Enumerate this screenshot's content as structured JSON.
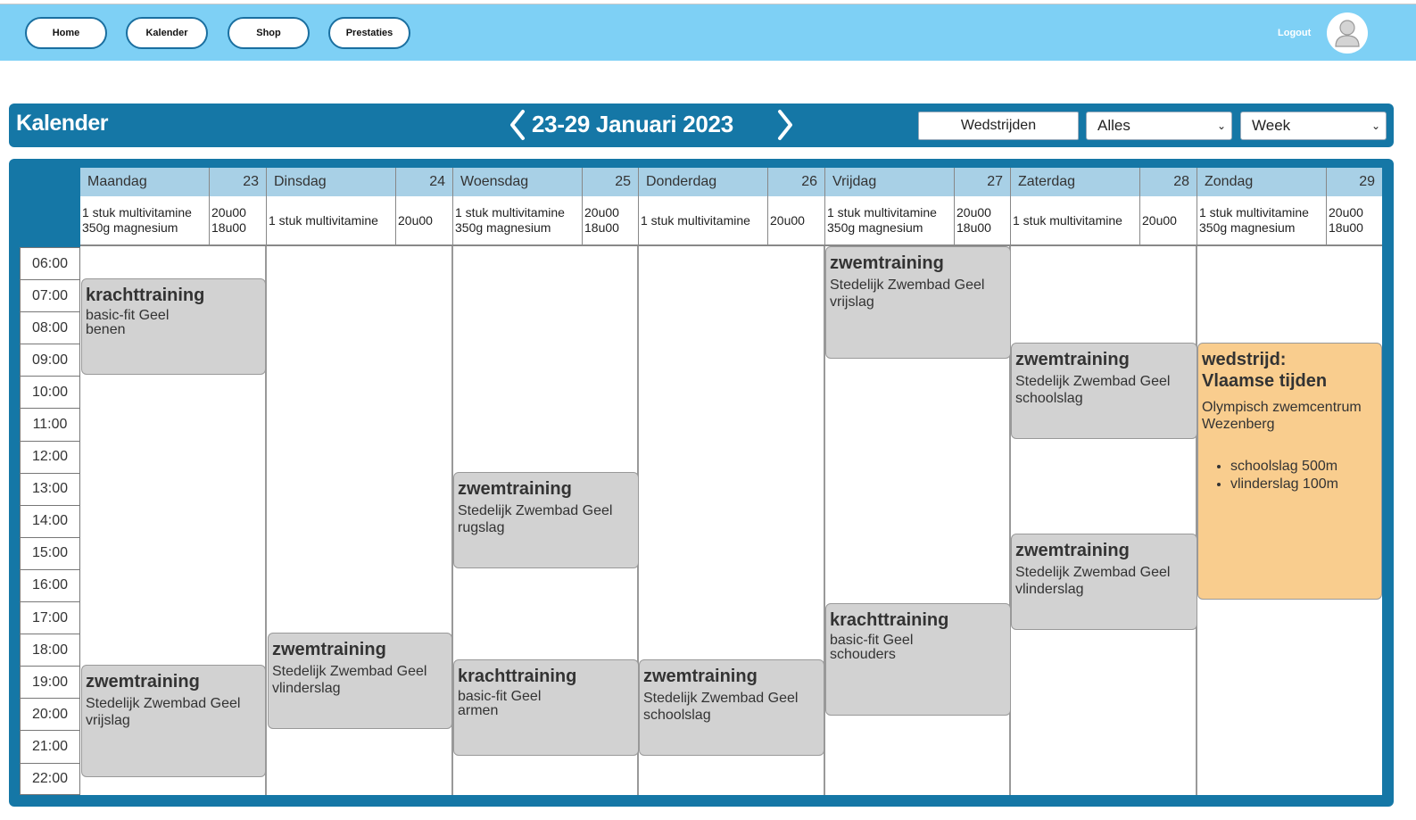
{
  "nav": {
    "home": "Home",
    "kalender": "Kalender",
    "shop": "Shop",
    "prestaties": "Prestaties",
    "logout": "Logout"
  },
  "header": {
    "title": "Kalender",
    "range": "23-29 Januari 2023",
    "wedstrijden_btn": "Wedstrijden",
    "filter_select": "Alles",
    "view_select": "Week"
  },
  "days": [
    {
      "name": "Maandag",
      "num": "23",
      "supp1": "1 stuk multivitamine",
      "supp2": "350g magnesium",
      "t1": "20u00",
      "t2": "18u00"
    },
    {
      "name": "Dinsdag",
      "num": "24",
      "supp1": "1 stuk multivitamine",
      "supp2": "",
      "t1": "20u00",
      "t2": ""
    },
    {
      "name": "Woensdag",
      "num": "25",
      "supp1": "1 stuk multivitamine",
      "supp2": "350g magnesium",
      "t1": "20u00",
      "t2": "18u00"
    },
    {
      "name": "Donderdag",
      "num": "26",
      "supp1": "1 stuk multivitamine",
      "supp2": "",
      "t1": "20u00",
      "t2": ""
    },
    {
      "name": "Vrijdag",
      "num": "27",
      "supp1": "1 stuk multivitamine",
      "supp2": "350g magnesium",
      "t1": "20u00",
      "t2": "18u00"
    },
    {
      "name": "Zaterdag",
      "num": "28",
      "supp1": "1 stuk multivitamine",
      "supp2": "",
      "t1": "20u00",
      "t2": ""
    },
    {
      "name": "Zondag",
      "num": "29",
      "supp1": "1 stuk multivitamine",
      "supp2": "350g magnesium",
      "t1": "20u00",
      "t2": "18u00"
    }
  ],
  "times": [
    "06:00",
    "07:00",
    "08:00",
    "09:00",
    "10:00",
    "11:00",
    "12:00",
    "13:00",
    "14:00",
    "15:00",
    "16:00",
    "17:00",
    "18:00",
    "19:00",
    "20:00",
    "21:00",
    "22:00"
  ],
  "events": {
    "mon_kracht": {
      "title": "krachttraining",
      "loc": "basic-fit Geel",
      "detail": "benen"
    },
    "mon_zwem": {
      "title": "zwemtraining",
      "loc": "Stedelijk Zwembad Geel",
      "detail": "vrijslag"
    },
    "tue_zwem": {
      "title": "zwemtraining",
      "loc": "Stedelijk Zwembad Geel",
      "detail": "vlinderslag"
    },
    "wed_zwem": {
      "title": "zwemtraining",
      "loc": "Stedelijk Zwembad Geel",
      "detail": "rugslag"
    },
    "wed_kracht": {
      "title": "krachttraining",
      "loc": "basic-fit Geel",
      "detail": "armen"
    },
    "thu_zwem": {
      "title": "zwemtraining",
      "loc": "Stedelijk Zwembad Geel",
      "detail": "schoolslag"
    },
    "fri_zwem": {
      "title": "zwemtraining",
      "loc": "Stedelijk Zwembad Geel",
      "detail": "vrijslag"
    },
    "fri_kracht": {
      "title": "krachttraining",
      "loc": "basic-fit Geel",
      "detail": "schouders"
    },
    "sat_zwem1": {
      "title": "zwemtraining",
      "loc": "Stedelijk Zwembad Geel",
      "detail": "schoolslag"
    },
    "sat_zwem2": {
      "title": "zwemtraining",
      "loc": "Stedelijk Zwembad Geel",
      "detail": "vlinderslag"
    },
    "sun_wedstrijd": {
      "title1": "wedstrijd:",
      "title2": "Vlaamse tijden",
      "loc1": "Olympisch zwemcentrum",
      "loc2": "Wezenberg",
      "items": [
        "schoolslag 500m",
        "vlinderslag 100m"
      ]
    }
  }
}
